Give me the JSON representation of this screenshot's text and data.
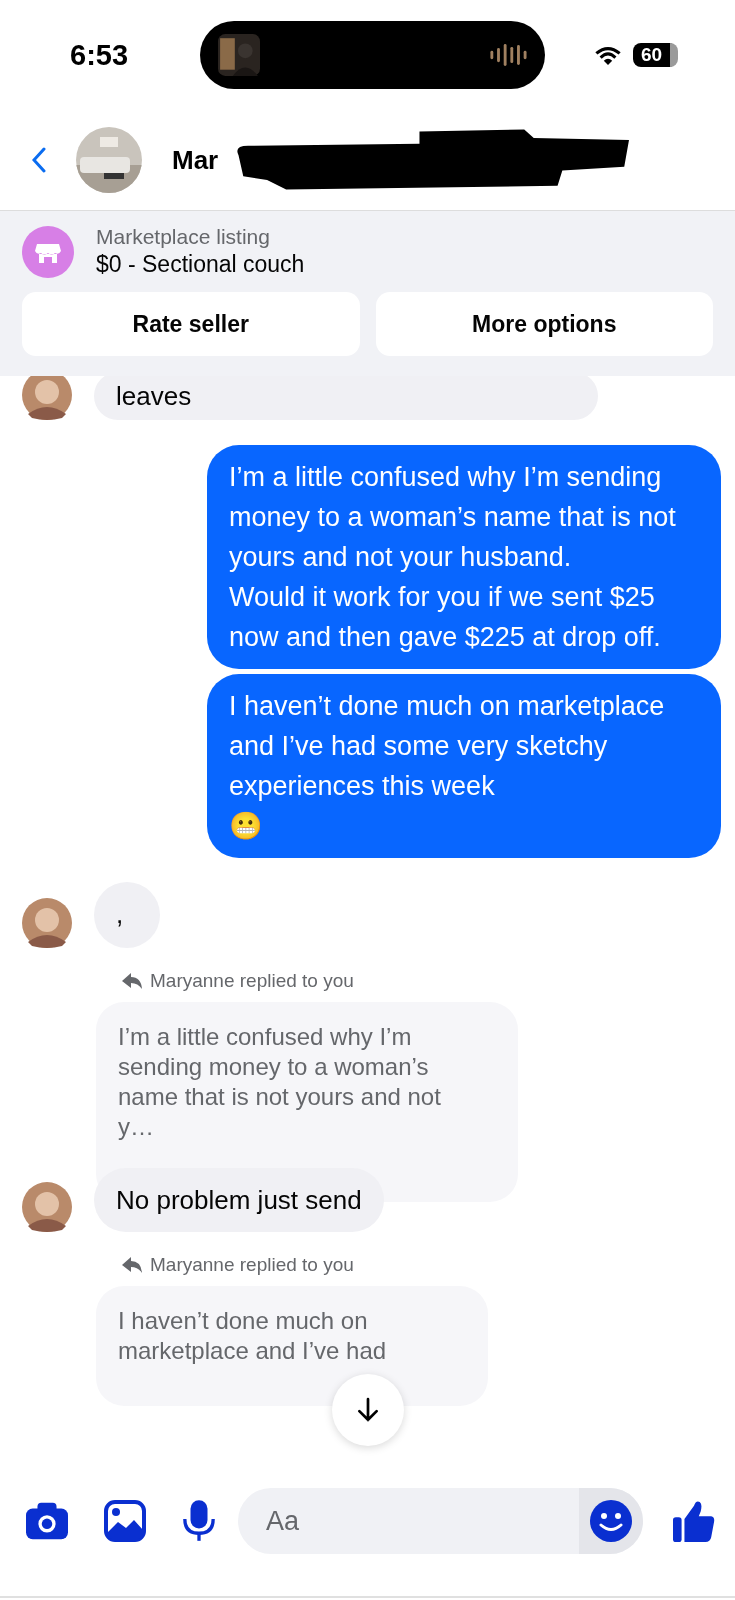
{
  "status_bar": {
    "time": "6:53",
    "battery": "60"
  },
  "header": {
    "contact_name": "Mar"
  },
  "listing": {
    "label": "Marketplace listing",
    "title": "$0 - Sectional couch",
    "buttons": [
      "Rate seller",
      "More options"
    ]
  },
  "messages": [
    {
      "kind": "incoming",
      "text": "leaves"
    },
    {
      "kind": "outgoing",
      "text": "I’m a little confused why I’m sending money to a woman’s name that is not yours and not your husband.\nWould it work for you if we sent $25 now and then gave $225 at drop off."
    },
    {
      "kind": "outgoing",
      "text": "I haven’t done much on marketplace and I’ve had some very sketchy experiences this week\n😬"
    },
    {
      "kind": "incoming",
      "text": ","
    },
    {
      "kind": "reply",
      "label": "Maryanne replied to you",
      "quote": "I’m a little confused why I’m sending money to a woman’s name that is not yours and not y…",
      "text": "No problem just send"
    },
    {
      "kind": "reply_cut",
      "label": "Maryanne replied to you",
      "quote": "I haven’t done much on marketplace and I’ve had"
    }
  ],
  "composer": {
    "placeholder": "Aa"
  }
}
